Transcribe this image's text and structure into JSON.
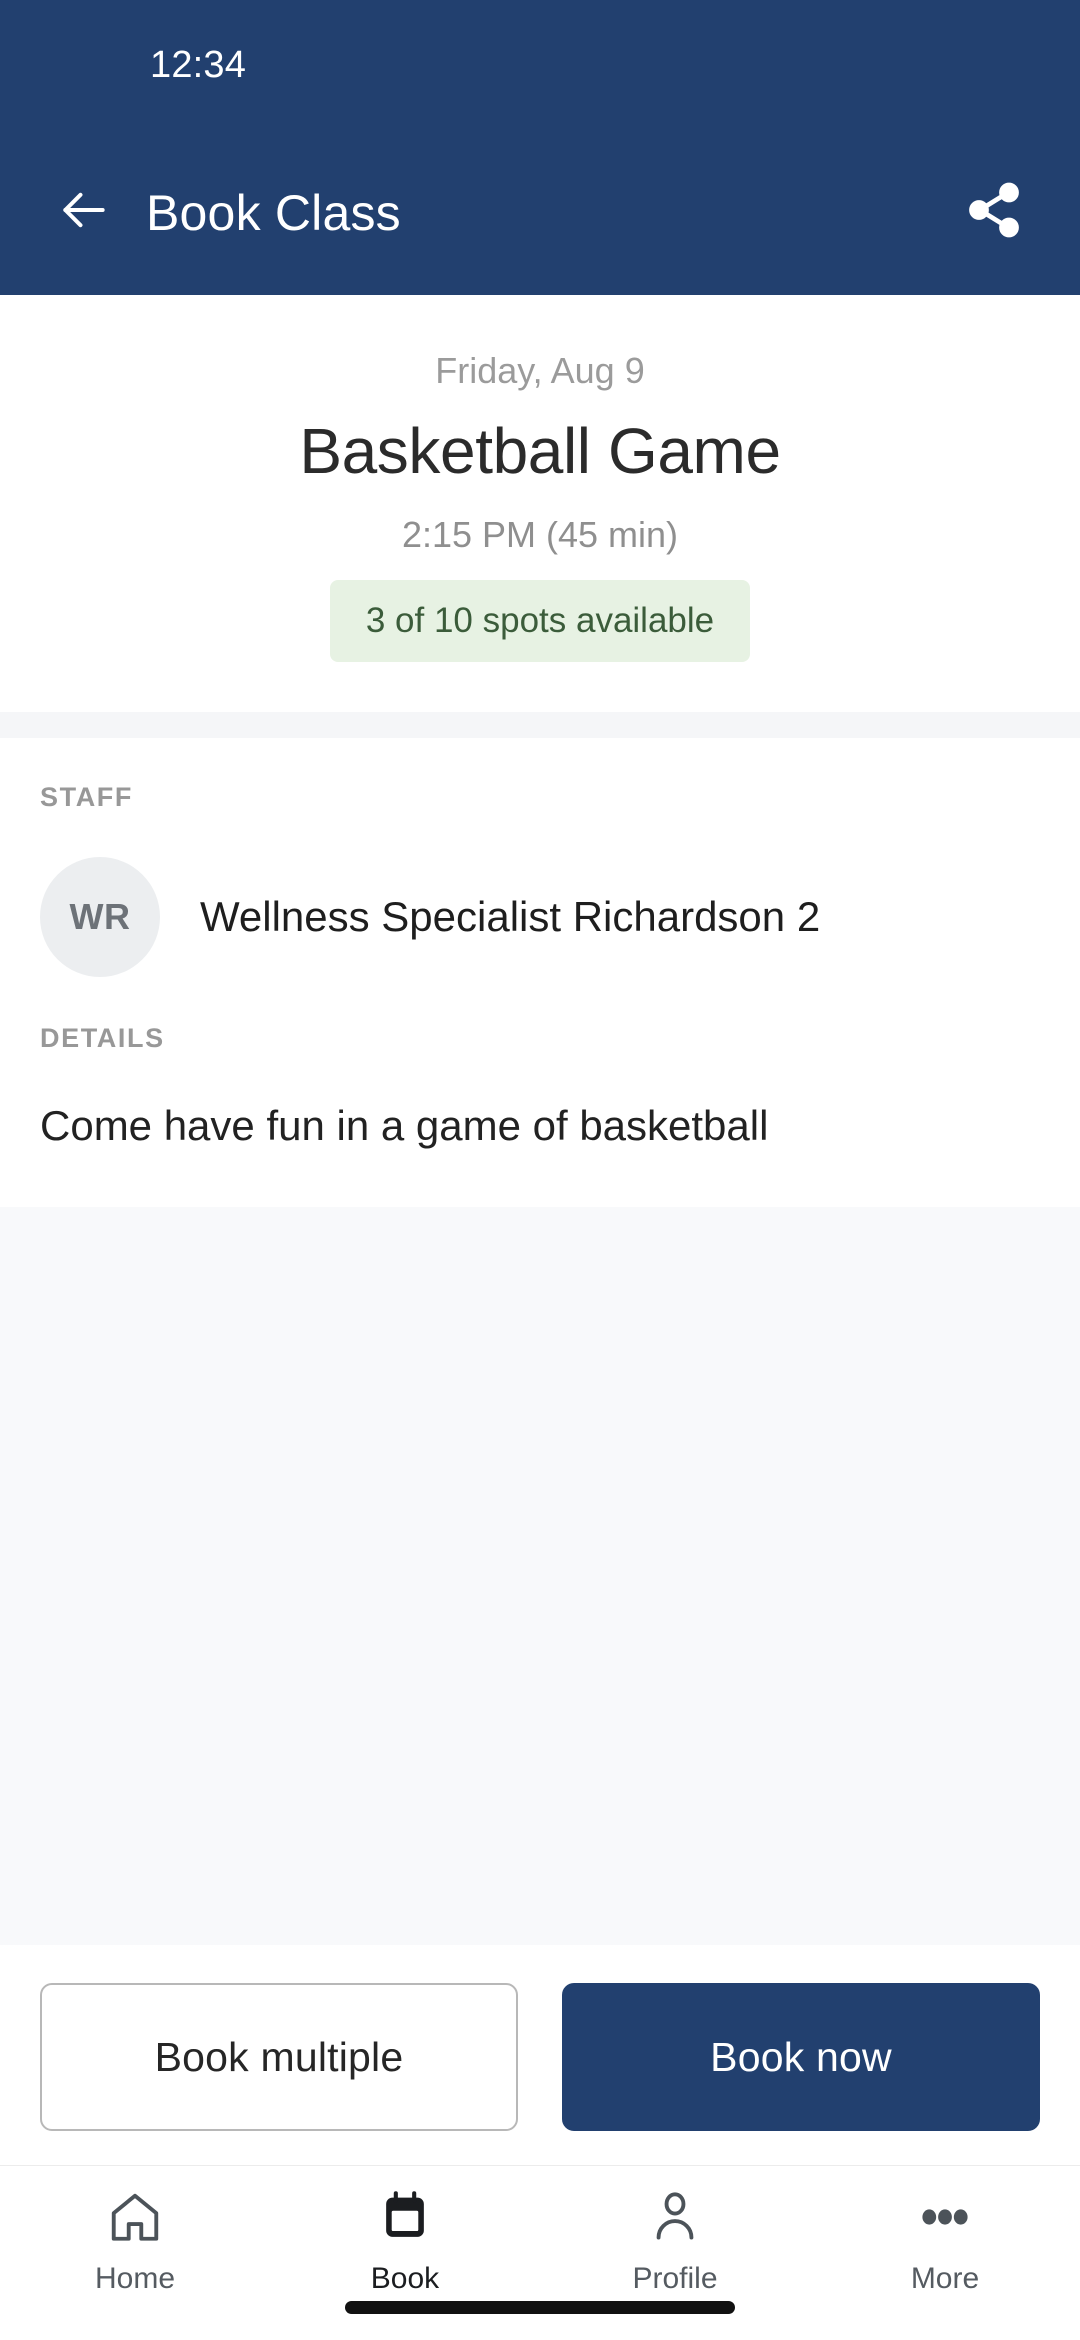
{
  "theme": {
    "primary": "#22406f",
    "badge_bg": "#e7f2e3",
    "badge_text": "#3b5c3a",
    "surface": "#ffffff",
    "muted_surface": "#f8f9fb"
  },
  "status_bar": {
    "time": "12:34"
  },
  "app_bar": {
    "title": "Book Class",
    "back_icon": "arrow-left-icon",
    "share_icon": "share-icon"
  },
  "hero": {
    "date": "Friday, Aug 9",
    "class_name": "Basketball Game",
    "time_duration": "2:15 PM (45 min)",
    "spots_badge": "3 of 10 spots available",
    "spots_available": 3,
    "spots_total": 10
  },
  "staff_section": {
    "label": "STAFF",
    "members": [
      {
        "initials": "WR",
        "name": "Wellness Specialist Richardson 2"
      }
    ]
  },
  "details_section": {
    "label": "DETAILS",
    "body": "Come have fun in a game of basketball"
  },
  "actions": {
    "secondary_label": "Book multiple",
    "primary_label": "Book now"
  },
  "bottom_nav": {
    "items": [
      {
        "label": "Home",
        "icon": "home-icon",
        "active": false
      },
      {
        "label": "Book",
        "icon": "calendar-icon",
        "active": true
      },
      {
        "label": "Profile",
        "icon": "person-icon",
        "active": false
      },
      {
        "label": "More",
        "icon": "more-dots-icon",
        "active": false
      }
    ]
  }
}
